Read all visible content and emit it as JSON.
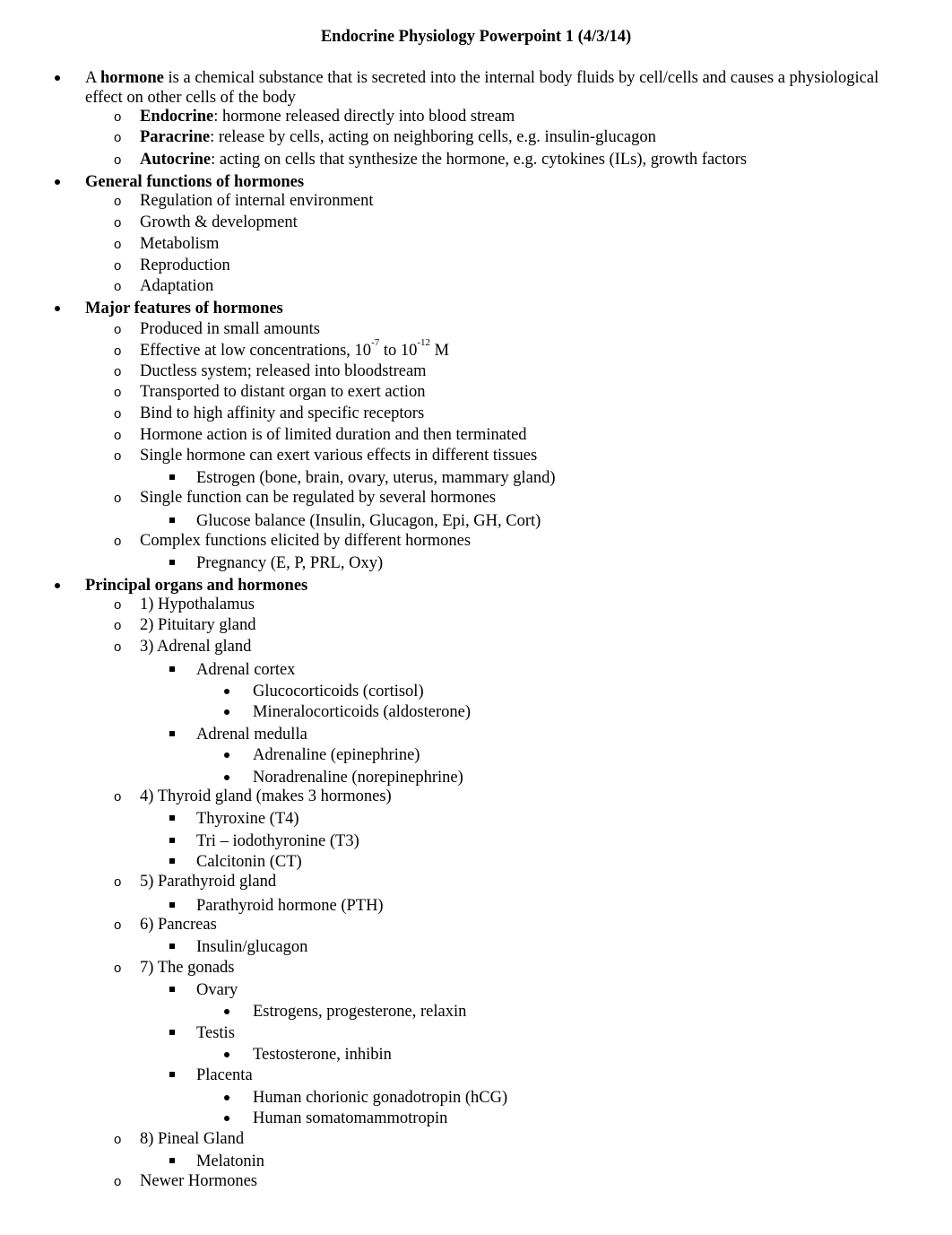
{
  "document": {
    "title": "Endocrine Physiology Powerpoint 1 (4/3/14)",
    "intro": {
      "prefix": "A ",
      "term": "hormone",
      "definition": " is a chemical substance that is secreted into the internal body fluids by cell/cells and causes a physiological effect on other cells of the body",
      "types": [
        {
          "term": "Endocrine",
          "text": ":  hormone released directly into blood stream"
        },
        {
          "term": "Paracrine",
          "text": ": release by cells, acting on neighboring cells, e.g. insulin-glucagon"
        },
        {
          "term": "Autocrine",
          "text": ": acting on cells that synthesize the hormone, e.g. cytokines (ILs), growth factors"
        }
      ]
    },
    "general_functions": {
      "heading": "General functions of hormones",
      "items": [
        "Regulation of internal environment",
        "Growth & development",
        "Metabolism",
        "Reproduction",
        "Adaptation"
      ]
    },
    "major_features": {
      "heading": "Major features of hormones",
      "items": [
        "Produced in small amounts",
        {
          "before": "Effective at low concentrations, 10",
          "sup1": "-7",
          "middle": " to 10",
          "sup2": "-12",
          "after": " M"
        },
        "Ductless system; released into bloodstream",
        "Transported to distant organ to exert action",
        "Bind to high affinity and specific receptors",
        "Hormone action is of limited duration and then terminated",
        "Single hormone can exert various effects in different tissues",
        "Estrogen (bone, brain, ovary, uterus, mammary gland)",
        "Single function can be regulated by several hormones",
        "Glucose balance (Insulin, Glucagon,  Epi, GH, Cort)",
        "Complex functions elicited by different hormones",
        "Pregnancy (E, P, PRL, Oxy)"
      ]
    },
    "principal_organs": {
      "heading": "Principal organs and hormones",
      "items": [
        "1) Hypothalamus",
        "2) Pituitary gland",
        "3) Adrenal gland",
        "Adrenal cortex",
        "Glucocorticoids (cortisol)",
        "Mineralocorticoids (aldosterone)",
        "Adrenal medulla",
        "Adrenaline (epinephrine)",
        "Noradrenaline (norepinephrine)",
        "4) Thyroid gland (makes 3 hormones)",
        "Thyroxine (T4)",
        "Tri – iodothyronine (T3)",
        "Calcitonin (CT)",
        "5) Parathyroid gland",
        "Parathyroid hormone (PTH)",
        "6) Pancreas",
        "Insulin/glucagon",
        "7) The gonads",
        "Ovary",
        "Estrogens, progesterone, relaxin",
        "Testis",
        "Testosterone, inhibin",
        "Placenta",
        "Human chorionic gonadotropin (hCG)",
        "Human somatomammotropin",
        "8) Pineal Gland",
        "Melatonin",
        "Newer Hormones"
      ]
    }
  }
}
